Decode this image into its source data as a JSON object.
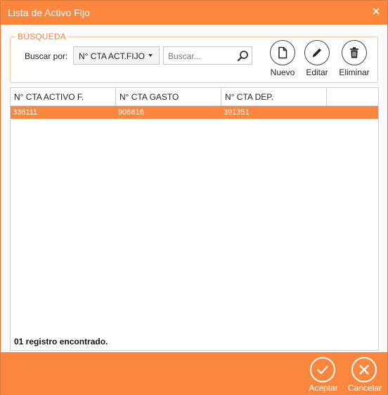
{
  "window": {
    "title": "Lista de Activo Fijo",
    "close_icon": "close-icon"
  },
  "search": {
    "group_label": "BÚSQUEDA",
    "buscar_label": "Buscar por:",
    "selected_field": "N° CTA ACT.FIJO",
    "placeholder": "Buscar...",
    "search_icon": "magnifier-icon"
  },
  "toolbar": {
    "nuevo_label": "Nuevo",
    "editar_label": "Editar",
    "eliminar_label": "Eliminar"
  },
  "grid": {
    "columns": [
      "N° CTA ACTIVO F.",
      "N° CTA GASTO",
      "N° CTA DEP."
    ],
    "rows": [
      {
        "cta_activo": "336111",
        "cta_gasto": "906816",
        "cta_dep": "391351",
        "selected": true
      }
    ],
    "status": "01 registro encontrado."
  },
  "actions": {
    "aceptar_label": "Aceptar",
    "cancelar_label": "Cancelar"
  },
  "colors": {
    "accent": "#fb873f",
    "group_border": "#f5c49d"
  }
}
